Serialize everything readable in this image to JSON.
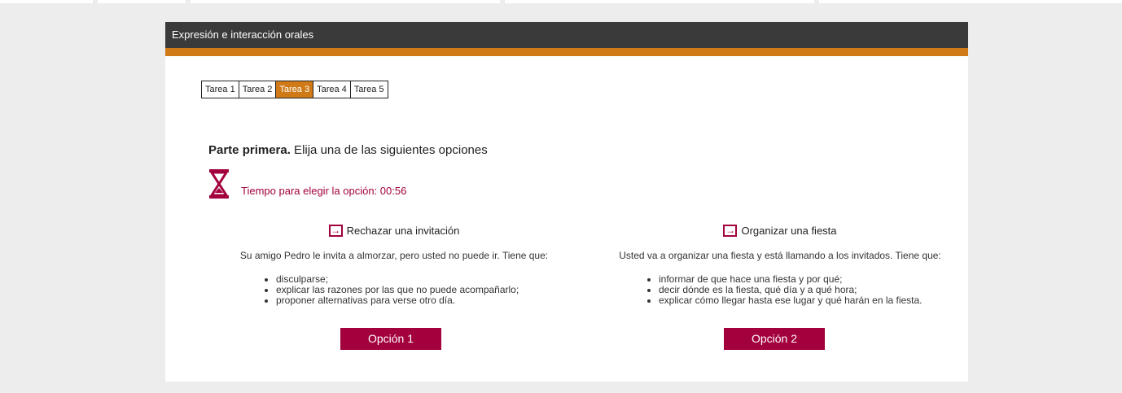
{
  "header": {
    "title": "Expresión e interacción orales"
  },
  "tabs": [
    {
      "label": "Tarea 1",
      "active": false
    },
    {
      "label": "Tarea 2",
      "active": false
    },
    {
      "label": "Tarea 3",
      "active": true
    },
    {
      "label": "Tarea 4",
      "active": false
    },
    {
      "label": "Tarea 5",
      "active": false
    }
  ],
  "instruction": {
    "bold": "Parte primera.",
    "text": " Elija una de las siguientes opciones"
  },
  "timer": {
    "icon": "hourglass-icon",
    "text": "Tiempo para elegir la opción: 00:56"
  },
  "options": [
    {
      "title": "Rechazar una invitación",
      "description": "Su amigo Pedro le invita a almorzar, pero usted no puede ir. Tiene que:",
      "items": [
        "disculparse;",
        "explicar las razones por las que no puede acompañarlo;",
        "proponer alternativas para verse otro día."
      ],
      "button": "Opción 1"
    },
    {
      "title": "Organizar una fiesta",
      "description": "Usted va a organizar una fiesta y está llamando a los invitados. Tiene que:",
      "items": [
        "informar de que hace una fiesta y por qué;",
        "decir dónde es la fiesta, qué día y a qué hora;",
        "explicar cómo llegar hasta ese lugar y qué harán en la fiesta."
      ],
      "button": "Opción 2"
    }
  ],
  "colors": {
    "header_bg": "#3a3a3a",
    "accent": "#cf7a17",
    "primary": "#a3003e",
    "page_bg": "#ededed"
  }
}
